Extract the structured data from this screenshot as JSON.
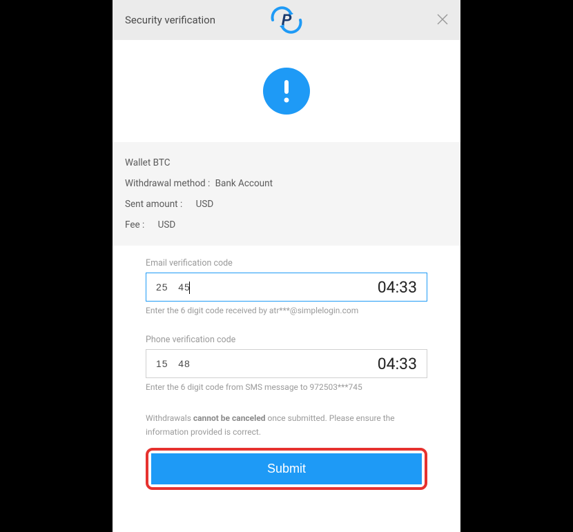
{
  "header": {
    "title": "Security verification"
  },
  "details": {
    "wallet": "Wallet BTC",
    "method_label": "Withdrawal method :",
    "method_value": "Bank Account",
    "amount_label": "Sent amount :",
    "amount_currency": "USD",
    "fee_label": "Fee :",
    "fee_currency": "USD"
  },
  "email_code": {
    "label": "Email verification code",
    "value": "25   45",
    "timer": "04:33",
    "helper": "Enter the 6 digit code received by atr***@simplelogin.com"
  },
  "phone_code": {
    "label": "Phone verification code",
    "value": "15   48",
    "timer": "04:33",
    "helper": "Enter the 6 digit code from SMS message to 972503***745"
  },
  "warning": {
    "prefix": "Withdrawals ",
    "bold": "cannot be canceled",
    "suffix": " once submitted. Please ensure the information provided is correct."
  },
  "submit": {
    "label": "Submit"
  }
}
